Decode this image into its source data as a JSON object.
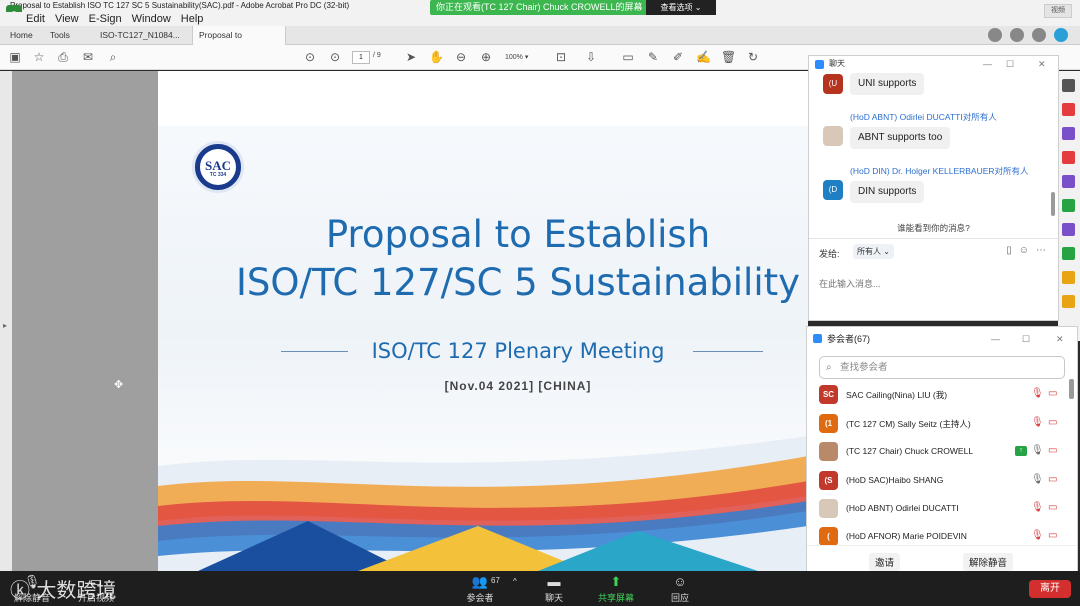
{
  "acrobat": {
    "window_title": "Proposal to Establish ISO TC 127 SC 5 Sustainability(SAC).pdf - Adobe Acrobat Pro DC (32-bit)",
    "menu": [
      "Edit",
      "View",
      "E-Sign",
      "Window",
      "Help"
    ],
    "tabs": [
      "Home",
      "Tools",
      "ISO-TC127_N1084...",
      "Proposal to Establis..."
    ],
    "tab_close": "×",
    "page_current": "1",
    "page_total": "/ 9",
    "zoom": "100%",
    "right_box": "视频"
  },
  "viewing_banner": {
    "text": "你正在观看(TC 127 Chair) Chuck CROWELL的屏幕",
    "options": "查看选项 ⌄"
  },
  "slide": {
    "logo_text": "SAC",
    "logo_sub": "TC 334",
    "title_line1": "Proposal to Establish",
    "title_line2": "ISO/TC 127/SC 5 Sustainability",
    "subtitle": "ISO/TC 127 Plenary Meeting",
    "date": "[Nov.04 2021] [CHINA]"
  },
  "chat": {
    "title": "聊天",
    "messages": [
      {
        "avatar": "(U",
        "sender": "",
        "text": "UNI supports",
        "avatar_color": "#b5331f"
      },
      {
        "avatar": "",
        "sender": "(HoD ABNT) Odirlei DUCATTI对所有人",
        "text": "ABNT supports too",
        "avatar_color": "#d8c8b8"
      },
      {
        "avatar": "(D",
        "sender": "(HoD DIN) Dr. Holger KELLERBAUER对所有人",
        "text": "DIN supports",
        "avatar_color": "#1e7fc4"
      }
    ],
    "who_sees": "谁能看到你的消息?",
    "send_to_label": "发给:",
    "send_to_value": "所有人 ⌄",
    "input_placeholder": "在此输入消息..."
  },
  "participants": {
    "title": "参会者(67)",
    "search_placeholder": "查找参会者",
    "rows": [
      {
        "avatar": "SC",
        "name": "SAC Cailing(Nina) LIU (我)",
        "color": "#c0392b",
        "mic": "muted"
      },
      {
        "avatar": "(1",
        "name": "(TC 127 CM) Sally Seitz (主持人)",
        "color": "#e06a10",
        "mic": "muted"
      },
      {
        "avatar": "",
        "name": "(TC 127 Chair) Chuck CROWELL",
        "color": "#b88a6a",
        "mic": "on"
      },
      {
        "avatar": "(S",
        "name": "(HoD SAC)Haibo SHANG",
        "color": "#c0392b",
        "mic": "on"
      },
      {
        "avatar": "",
        "name": "(HoD ABNT) Odirlei DUCATTI",
        "color": "#d8c8b8",
        "mic": "muted"
      },
      {
        "avatar": "(",
        "name": "(HoD AFNOR) Marie POIDEVIN",
        "color": "#e06a10",
        "mic": "muted"
      }
    ],
    "invite": "邀请",
    "unmute_all": "解除静音"
  },
  "zoom_bar": {
    "mute": "解除静音",
    "video": "开启视频",
    "participants": "参会者",
    "participant_count": "67",
    "chat": "聊天",
    "share": "共享屏幕",
    "reactions": "回应",
    "leave": "离开"
  },
  "watermark": "大数跨境"
}
